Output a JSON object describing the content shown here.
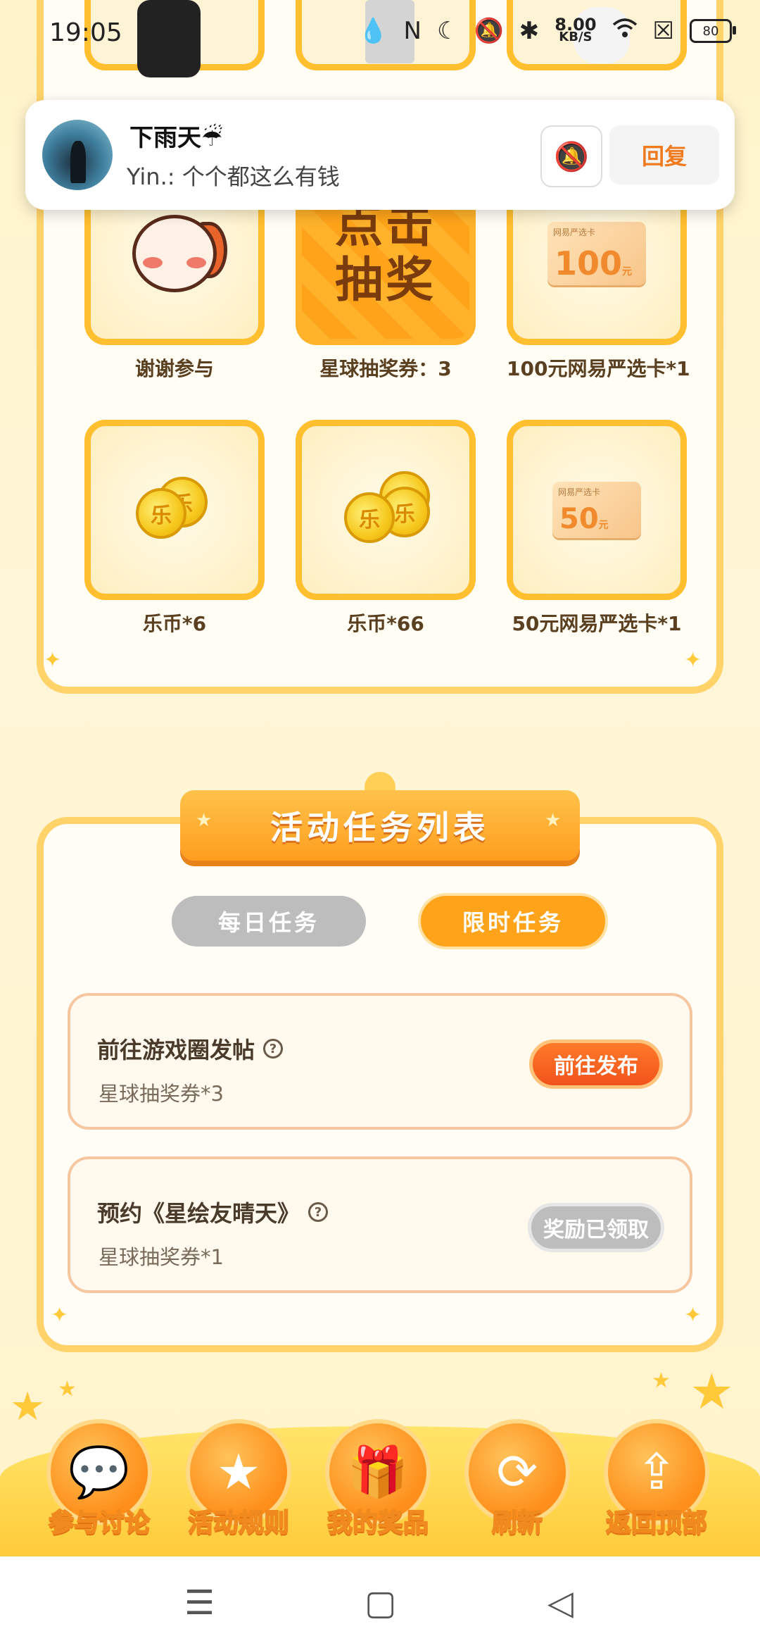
{
  "status": {
    "time": "19:05",
    "speed_value": "8.00",
    "speed_unit": "KB/S",
    "battery": "80"
  },
  "notification": {
    "title": "下雨天☔",
    "body": "Yin.: 个个都这么有钱",
    "reply_label": "回复"
  },
  "prizes": [
    {
      "label": "谢谢参与"
    },
    {
      "label": "星球抽奖券：3",
      "tile_text_1": "点击",
      "tile_text_2": "抽奖"
    },
    {
      "label": "100元网易严选卡*1",
      "card_amount": "100",
      "card_unit": "元",
      "card_brand": "网易严选卡"
    },
    {
      "label": "乐币*6",
      "coin_glyph": "乐"
    },
    {
      "label": "乐币*66",
      "coin_glyph": "乐"
    },
    {
      "label": "50元网易严选卡*1",
      "card_amount": "50",
      "card_unit": "元",
      "card_brand": "网易严选卡"
    }
  ],
  "tasks_section": {
    "title": "活动任务列表",
    "tab_daily": "每日任务",
    "tab_limited": "限时任务",
    "active_tab": "限时任务",
    "tasks": [
      {
        "name": "前往游戏圈发帖",
        "reward": "星球抽奖券*3",
        "button": "前往发布",
        "state": "active"
      },
      {
        "name": "预约《星绘友晴天》",
        "reward": "星球抽奖券*1",
        "button": "奖励已领取",
        "state": "done"
      }
    ]
  },
  "actions": [
    {
      "label": "参与讨论",
      "icon": "chat-icon"
    },
    {
      "label": "活动规则",
      "icon": "star-icon"
    },
    {
      "label": "我的奖品",
      "icon": "gift-icon"
    },
    {
      "label": "刷新",
      "icon": "refresh-icon"
    },
    {
      "label": "返回顶部",
      "icon": "upload-icon"
    }
  ],
  "colors": {
    "accent": "#ffa41a",
    "panel_border": "#ffd36a",
    "background": "#fff4cf"
  }
}
